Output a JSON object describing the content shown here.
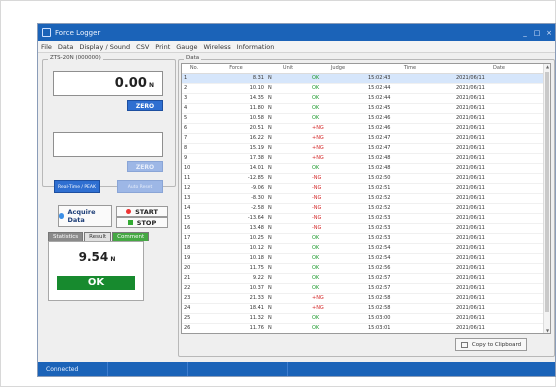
{
  "window": {
    "title": "Force Logger",
    "controls": [
      "_",
      "□",
      "×"
    ]
  },
  "menu": [
    "File",
    "Data",
    "Display / Sound",
    "CSV",
    "Print",
    "Gauge",
    "Wireless",
    "Information"
  ],
  "left_panel": {
    "device_group_label": "ZTS-20N (000000)",
    "force_value": "0.00",
    "force_unit": "N",
    "zero_label": "ZERO",
    "mode_buttons": [
      "Real-Time / PEAK",
      "Auto Reset"
    ],
    "acquire_label": "Acquire Data",
    "start_label": "START",
    "stop_label": "STOP",
    "tabs": [
      "Statistics",
      "Result",
      "Comment"
    ],
    "result_value": "9.54",
    "result_unit": "N",
    "result_status": "OK"
  },
  "data_panel": {
    "group_label": "Data",
    "columns": [
      "No.",
      "Force",
      "Unit",
      "Judge",
      "Time",
      "Date"
    ],
    "rows": [
      [
        "1",
        "8.31",
        "N",
        "OK",
        "15:02:43",
        "2021/06/11"
      ],
      [
        "2",
        "10.10",
        "N",
        "OK",
        "15:02:44",
        "2021/06/11"
      ],
      [
        "3",
        "14.35",
        "N",
        "OK",
        "15:02:44",
        "2021/06/11"
      ],
      [
        "4",
        "11.80",
        "N",
        "OK",
        "15:02:45",
        "2021/06/11"
      ],
      [
        "5",
        "10.58",
        "N",
        "OK",
        "15:02:46",
        "2021/06/11"
      ],
      [
        "6",
        "20.51",
        "N",
        "+NG",
        "15:02:46",
        "2021/06/11"
      ],
      [
        "7",
        "16.22",
        "N",
        "+NG",
        "15:02:47",
        "2021/06/11"
      ],
      [
        "8",
        "15.19",
        "N",
        "+NG",
        "15:02:47",
        "2021/06/11"
      ],
      [
        "9",
        "17.38",
        "N",
        "+NG",
        "15:02:48",
        "2021/06/11"
      ],
      [
        "10",
        "14.01",
        "N",
        "OK",
        "15:02:48",
        "2021/06/11"
      ],
      [
        "11",
        "-12.85",
        "N",
        "-NG",
        "15:02:50",
        "2021/06/11"
      ],
      [
        "12",
        "-9.06",
        "N",
        "-NG",
        "15:02:51",
        "2021/06/11"
      ],
      [
        "13",
        "-8.30",
        "N",
        "-NG",
        "15:02:52",
        "2021/06/11"
      ],
      [
        "14",
        "-2.58",
        "N",
        "-NG",
        "15:02:52",
        "2021/06/11"
      ],
      [
        "15",
        "-13.64",
        "N",
        "-NG",
        "15:02:53",
        "2021/06/11"
      ],
      [
        "16",
        "13.48",
        "N",
        "-NG",
        "15:02:53",
        "2021/06/11"
      ],
      [
        "17",
        "10.25",
        "N",
        "OK",
        "15:02:53",
        "2021/06/11"
      ],
      [
        "18",
        "10.12",
        "N",
        "OK",
        "15:02:54",
        "2021/06/11"
      ],
      [
        "19",
        "10.18",
        "N",
        "OK",
        "15:02:54",
        "2021/06/11"
      ],
      [
        "20",
        "11.75",
        "N",
        "OK",
        "15:02:56",
        "2021/06/11"
      ],
      [
        "21",
        "9.22",
        "N",
        "OK",
        "15:02:57",
        "2021/06/11"
      ],
      [
        "22",
        "10.37",
        "N",
        "OK",
        "15:02:57",
        "2021/06/11"
      ],
      [
        "23",
        "21.33",
        "N",
        "+NG",
        "15:02:58",
        "2021/06/11"
      ],
      [
        "24",
        "18.41",
        "N",
        "+NG",
        "15:02:58",
        "2021/06/11"
      ],
      [
        "25",
        "11.32",
        "N",
        "OK",
        "15:03:00",
        "2021/06/11"
      ],
      [
        "26",
        "11.76",
        "N",
        "OK",
        "15:03:01",
        "2021/06/11"
      ]
    ],
    "copy_label": "Copy to Clipboard"
  },
  "status": {
    "text": "Connected"
  },
  "colors": {
    "accent": "#1b63b8",
    "ok": "#178a2e",
    "ng": "#d42a2a",
    "start_icon": "#e33333",
    "stop_icon": "#33aa33"
  }
}
